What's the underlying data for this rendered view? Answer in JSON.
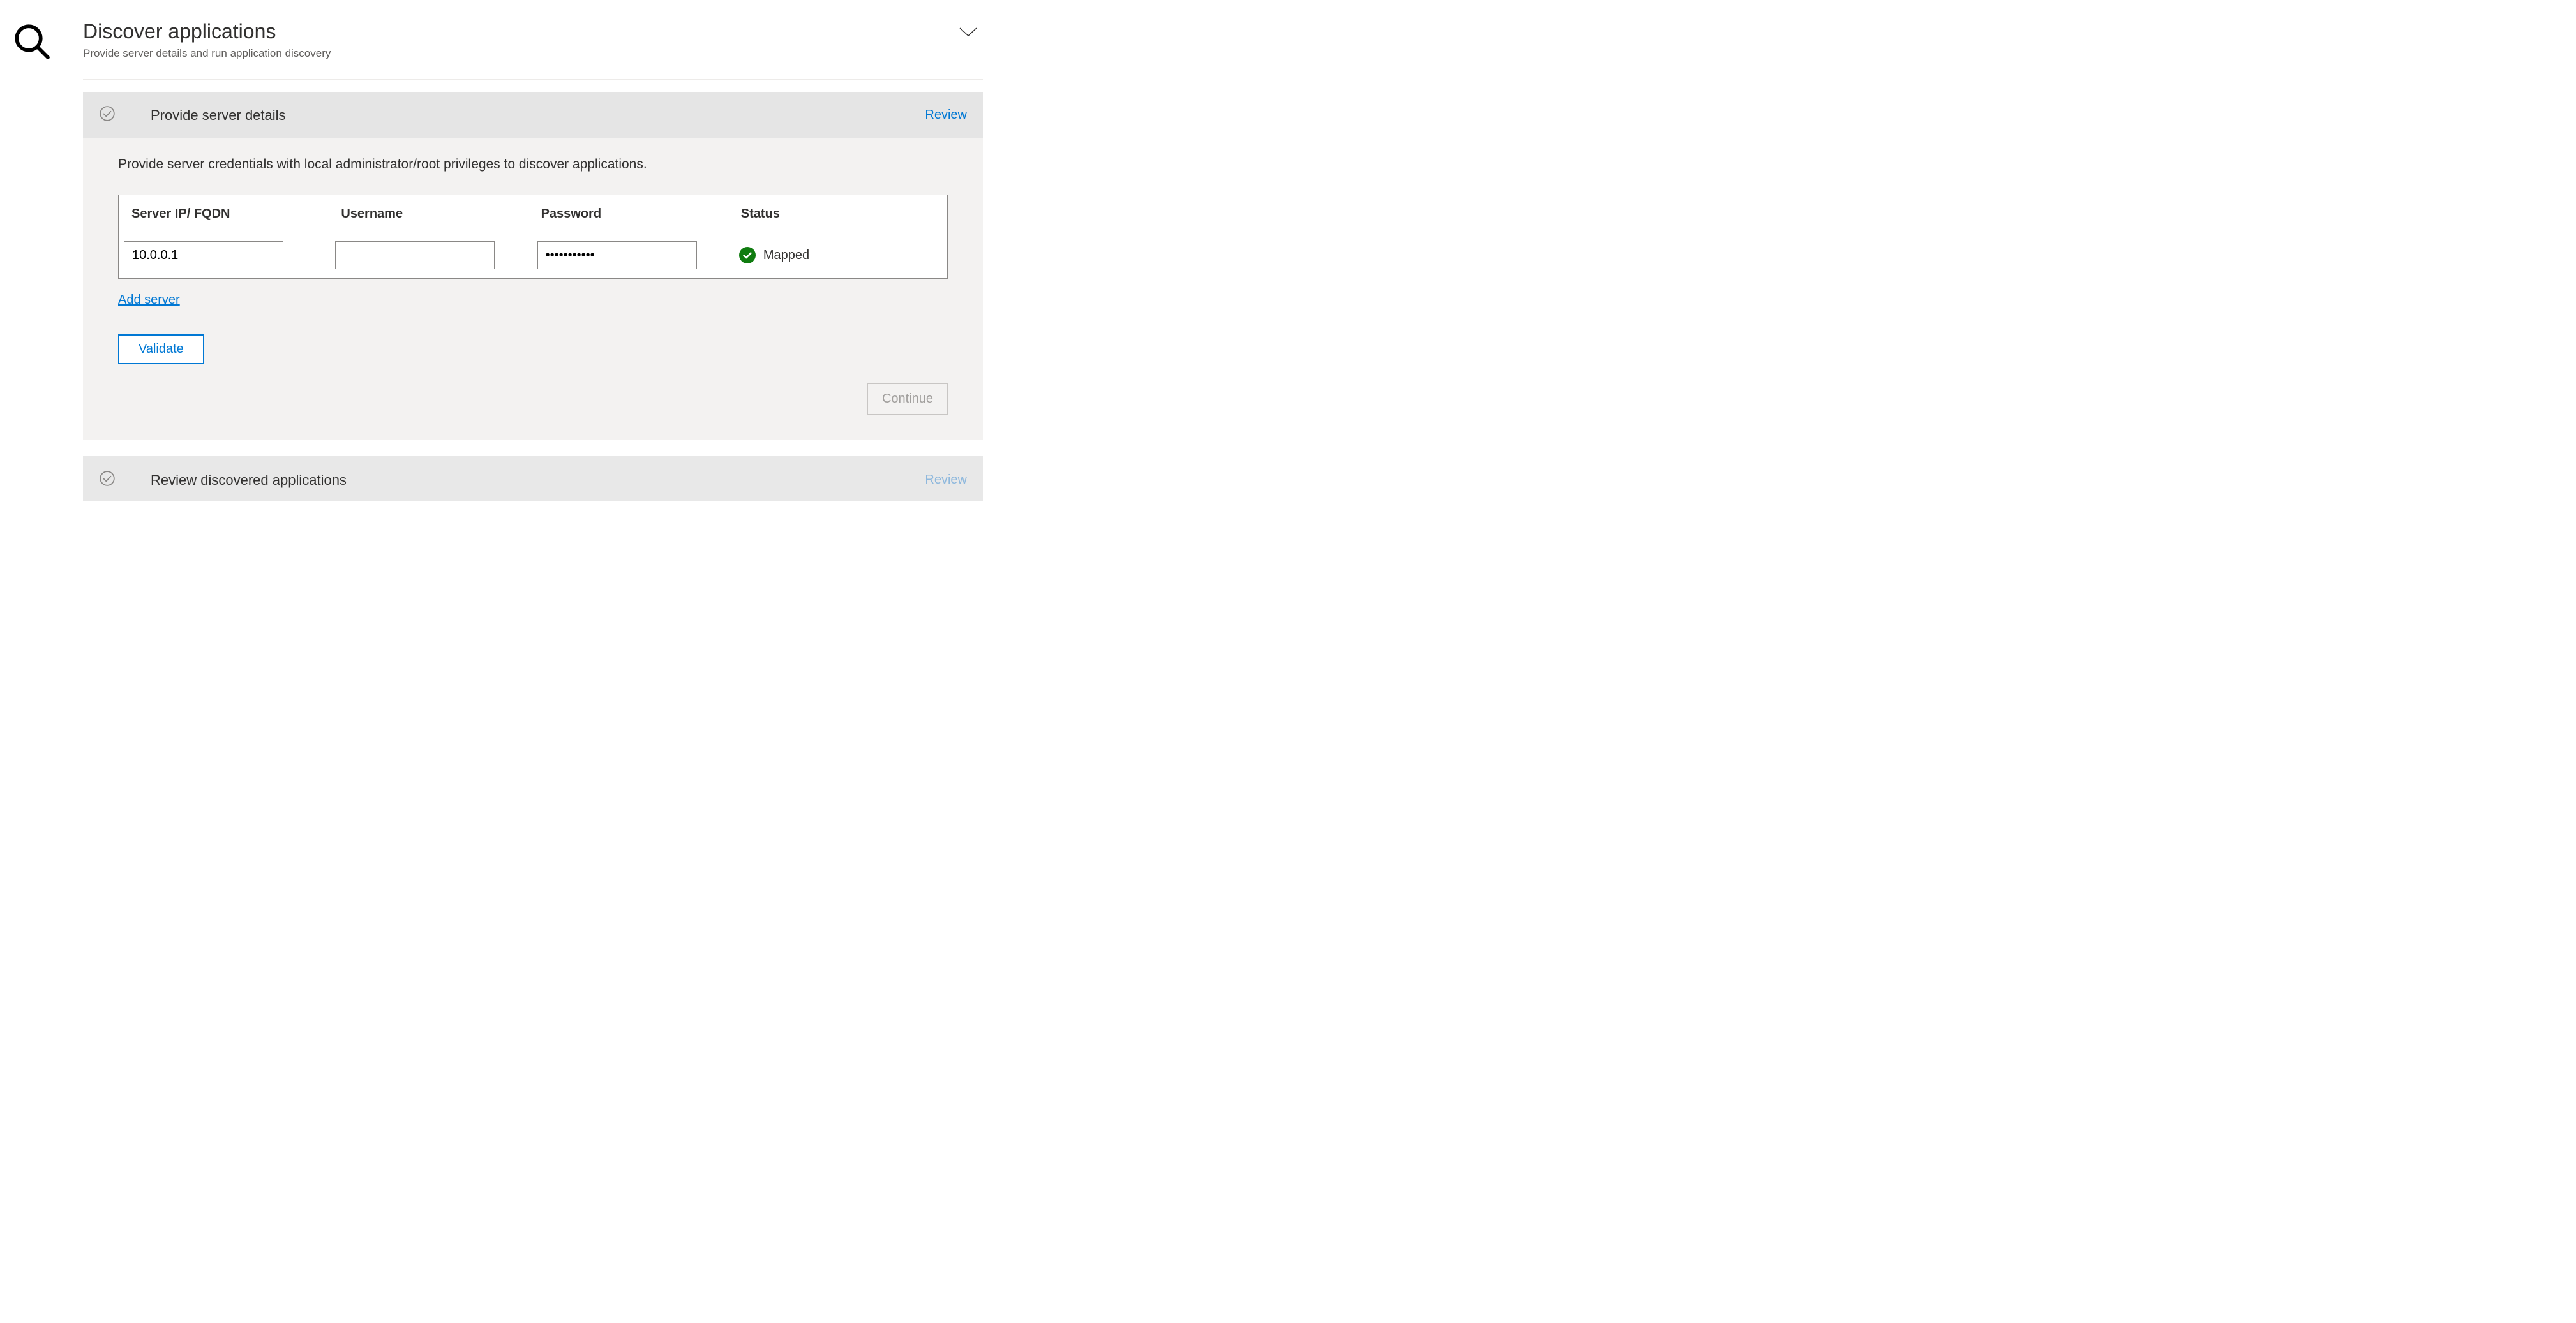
{
  "header": {
    "title": "Discover applications",
    "subtitle": "Provide server details and run application discovery"
  },
  "section1": {
    "title": "Provide server details",
    "action": "Review",
    "instruction": "Provide server credentials with local administrator/root privileges to discover applications.",
    "columns": {
      "server": "Server IP/ FQDN",
      "username": "Username",
      "password": "Password",
      "status": "Status"
    },
    "rows": [
      {
        "server": "10.0.0.1",
        "username": "",
        "password": "•••••••••••",
        "status_label": "Mapped"
      }
    ],
    "add_server_label": "Add server",
    "validate_label": "Validate",
    "continue_label": "Continue"
  },
  "section2": {
    "title": "Review discovered applications",
    "action": "Review"
  }
}
